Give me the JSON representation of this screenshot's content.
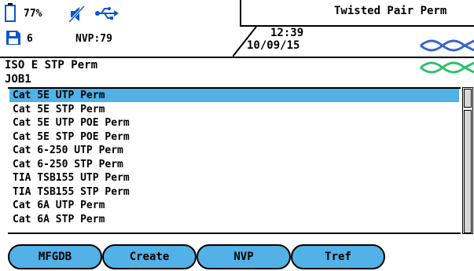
{
  "status": {
    "battery_percent": "77%",
    "memory_count": "6",
    "nvp_label": "NVP:79",
    "time": "12:39",
    "date": "10/09/15",
    "title": "Twisted Pair Perm"
  },
  "test_info": {
    "limit": "ISO E STP Perm",
    "job": "JOB1"
  },
  "list": {
    "selected_index": 0,
    "items": [
      "Cat 5E UTP Perm",
      "Cat 5E STP Perm",
      "Cat 5E UTP POE Perm",
      "Cat 5E STP POE Perm",
      "Cat 6-250 UTP Perm",
      "Cat 6-250 STP Perm",
      "TIA TSB155 UTP Perm",
      "TIA TSB155 STP Perm",
      "Cat 6A UTP Perm",
      "Cat 6A STP Perm"
    ]
  },
  "softkeys": [
    "MFGDB",
    "Create",
    "NVP",
    "Tref"
  ],
  "colors": {
    "accent": "#52b1e6",
    "cable_blue": "#3a66c8",
    "cable_green": "#2fbf6f"
  }
}
